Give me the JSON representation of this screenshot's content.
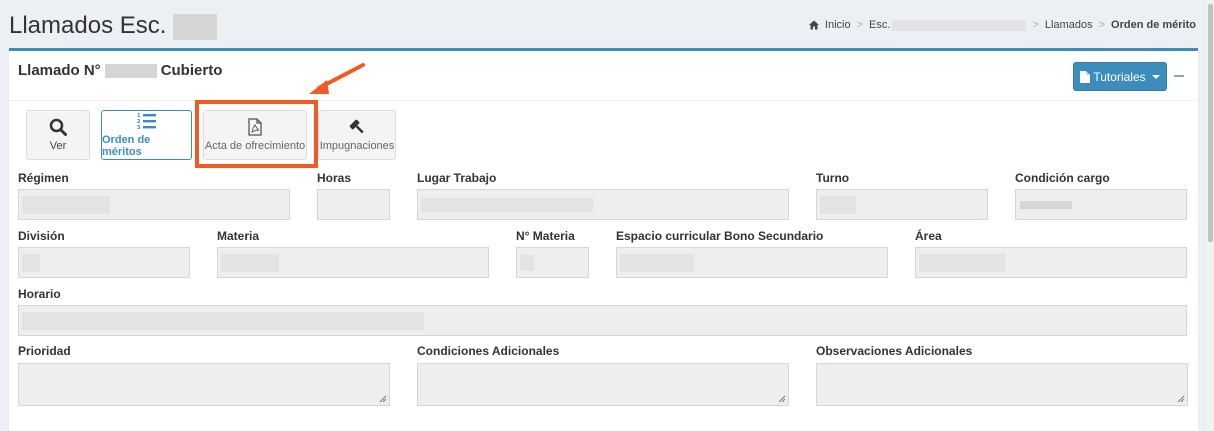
{
  "page": {
    "title": "Llamados Esc."
  },
  "breadcrumb": {
    "home": "Inicio",
    "school": "Esc.",
    "llamados": "Llamados",
    "current": "Orden de mérito"
  },
  "box": {
    "title_prefix": "Llamado N°",
    "title_suffix": "Cubierto",
    "tutorials_label": "Tutoriales"
  },
  "actions": [
    {
      "label": "Ver",
      "icon": "search-icon"
    },
    {
      "label": "Orden de méritos",
      "icon": "ordered-list-icon",
      "active": true
    },
    {
      "label": "Acta de ofrecimiento",
      "icon": "pdf-file-icon",
      "highlighted": true
    },
    {
      "label": "Impugnaciones",
      "icon": "gavel-icon"
    }
  ],
  "fields": {
    "regimen": "Régimen",
    "horas": "Horas",
    "lugar_trabajo": "Lugar Trabajo",
    "turno": "Turno",
    "condicion_cargo": "Condición cargo",
    "division": "División",
    "materia": "Materia",
    "n_materia": "N° Materia",
    "espacio_curricular": "Espacio curricular Bono Secundario",
    "area": "Área",
    "horario": "Horario",
    "prioridad": "Prioridad",
    "condiciones_adicionales": "Condiciones Adicionales",
    "observaciones_adicionales": "Observaciones Adicionales"
  },
  "colors": {
    "primary": "#3c8dbc",
    "highlight": "#f05a24",
    "background": "#ecf0f5",
    "field_bg": "#eeeeee"
  }
}
